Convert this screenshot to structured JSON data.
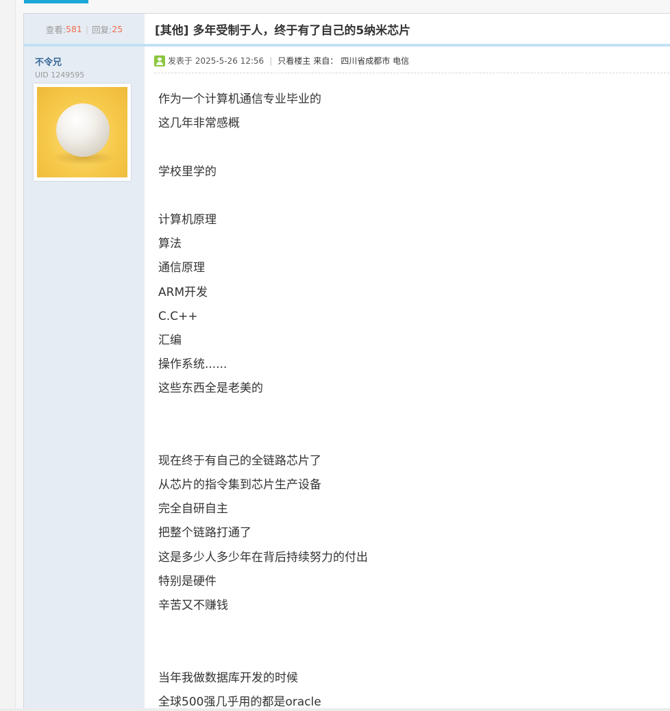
{
  "top_tab": {
    "accent_color": "#1ba8d8"
  },
  "stats": {
    "views_label": "查看:",
    "views": "581",
    "separator": "|",
    "replies_label": "回复:",
    "replies": "25"
  },
  "thread": {
    "title": "[其他] 多年受制于人，终于有了自己的5纳米芯片"
  },
  "author": {
    "name": "不令兄",
    "uid": "UID 1249595",
    "avatar_icon": "avatar-ball-image"
  },
  "post_meta": {
    "posted_at": "发表于 2025-5-26 12:56",
    "separator": "|",
    "only_author": "只看楼主",
    "from_label": "来自：",
    "from_location": "四川省成都市 电信"
  },
  "post_body": {
    "lines": [
      "作为一个计算机通信专业毕业的",
      "这几年非常感概",
      "",
      "学校里学的",
      "",
      "计算机原理",
      "算法",
      "通信原理",
      "ARM开发",
      "C.C++",
      "汇编",
      "操作系统......",
      "这些东西全是老美的",
      "",
      "",
      "现在终于有自己的全链路芯片了",
      "从芯片的指令集到芯片生产设备",
      "完全自研自主",
      "把整个链路打通了",
      "这是多少人多少年在背后持续努力的付出",
      "特别是硬件",
      "辛苦又不赚钱",
      "",
      "",
      "当年我做数据库开发的时候",
      "全球500强几乎用的都是oracle"
    ]
  }
}
